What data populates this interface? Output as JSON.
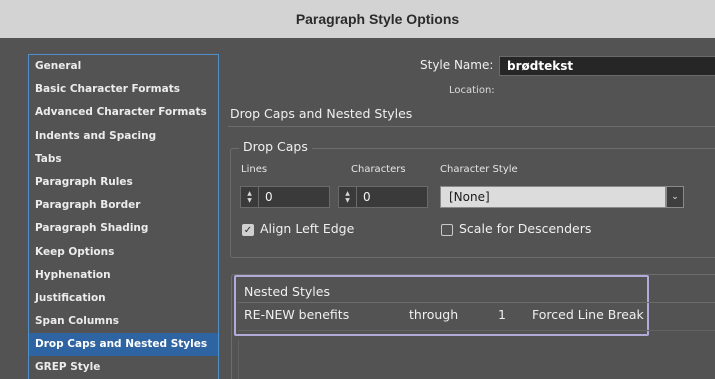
{
  "dialog": {
    "title": "Paragraph Style Options"
  },
  "sidebar": {
    "items": [
      {
        "label": "General"
      },
      {
        "label": "Basic Character Formats"
      },
      {
        "label": "Advanced Character Formats"
      },
      {
        "label": "Indents and Spacing"
      },
      {
        "label": "Tabs"
      },
      {
        "label": "Paragraph Rules"
      },
      {
        "label": "Paragraph Border"
      },
      {
        "label": "Paragraph Shading"
      },
      {
        "label": "Keep Options"
      },
      {
        "label": "Hyphenation"
      },
      {
        "label": "Justification"
      },
      {
        "label": "Span Columns"
      },
      {
        "label": "Drop Caps and Nested Styles",
        "selected": true
      },
      {
        "label": "GREP Style"
      }
    ]
  },
  "style": {
    "name_label": "Style Name:",
    "name_value": "brødtekst",
    "location_label": "Location:"
  },
  "section": {
    "title": "Drop Caps and Nested Styles",
    "drop_caps": {
      "title": "Drop Caps",
      "lines_label": "Lines",
      "lines_value": "0",
      "characters_label": "Characters",
      "characters_value": "0",
      "character_style_label": "Character Style",
      "character_style_value": "[None]",
      "align_left_edge_label": "Align Left Edge",
      "align_left_edge_checked": true,
      "scale_descenders_label": "Scale for Descenders",
      "scale_descenders_checked": false
    },
    "nested_styles": {
      "title": "Nested Styles",
      "rows": [
        {
          "style": "RE-NEW benefits",
          "mode": "through",
          "count": "1",
          "until": "Forced Line Break"
        }
      ]
    }
  },
  "colors": {
    "panel_bg": "#535353",
    "selection_blue": "#2e64a2",
    "highlight_lavender": "#b3aad9"
  }
}
